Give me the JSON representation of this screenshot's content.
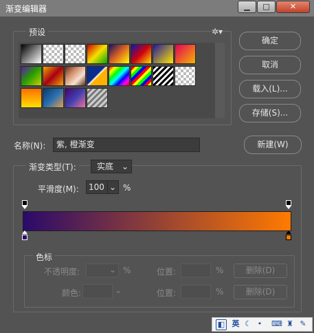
{
  "window": {
    "title": "渐变编辑器"
  },
  "presets": {
    "label": "预设",
    "gear_icon": "gear-icon",
    "swatches": [
      {
        "css": "linear-gradient(135deg,#000,#fff)"
      },
      {
        "css": "linear-gradient(135deg,#000,transparent)",
        "checker": true
      },
      {
        "css": "linear-gradient(135deg,#fff,transparent)",
        "checker": true
      },
      {
        "css": "linear-gradient(135deg,#c00,#f6e000,#0a0)"
      },
      {
        "css": "linear-gradient(135deg,#1a0f5c,#d62,#ff0)"
      },
      {
        "css": "linear-gradient(135deg,#0a1aa6,#d00010,#ffe000)"
      },
      {
        "css": "linear-gradient(135deg,#2318a0,#ffe500)"
      },
      {
        "css": "linear-gradient(135deg,#e2005a,#f6b400)"
      },
      {
        "css": "linear-gradient(135deg,#5a1aa6,#28a000,#c8d000)"
      },
      {
        "css": "linear-gradient(135deg,#f3a500,#a80012,#f3a500)"
      },
      {
        "css": "linear-gradient(135deg,#60301a,#d08e6a,#f8e0d0,#60301a)"
      },
      {
        "css": "linear-gradient(135deg,#0a2c8c 45%,#fff 50%,#ffb000 55%)"
      },
      {
        "css": "linear-gradient(135deg,#f00,#ff0,#0f0,#0ff,#00f,#f0f,#f00)"
      },
      {
        "css": "repeating-linear-gradient(135deg,#f00 0 4px,#ff0 4px 8px,#0f0 8px 12px,#00f 12px 16px)"
      },
      {
        "css": "repeating-linear-gradient(135deg,#000 0 3px,#fff 3px 6px)"
      },
      {
        "css": "transparent",
        "checker": true
      },
      {
        "css": "linear-gradient(180deg,#ff6d00,#ffe000)"
      },
      {
        "css": "linear-gradient(135deg,#0b3b6a,#2a6fb0,#e0a050)"
      },
      {
        "css": "linear-gradient(135deg,#4e006e,#4040b0,#f070a0)"
      },
      {
        "css": "repeating-linear-gradient(135deg,#ccc 0 3px,#777 3px 6px)"
      }
    ]
  },
  "buttons": {
    "ok": "确定",
    "cancel": "取消",
    "load": "载入(L)...",
    "save": "存储(S)...",
    "new": "新建(W)"
  },
  "name_field": {
    "label": "名称(N):",
    "value": "紫, 橙渐变"
  },
  "gradient": {
    "type_label": "渐变类型(T):",
    "type_value": "实底",
    "smooth_label": "平滑度(M):",
    "smooth_value": "100",
    "smooth_unit": "%",
    "start_color": "#2a0a6a",
    "end_color": "#ff7a00",
    "color_stop_left": "#2a0a6a",
    "color_stop_right": "#ff7a00",
    "opacity_stop_left": "#000000",
    "opacity_stop_right": "#000000"
  },
  "stops": {
    "legend": "色标",
    "opacity_label": "不透明度:",
    "opacity_unit": "%",
    "location_label": "位置:",
    "location_unit": "%",
    "delete_label": "删除(D)",
    "color_label": "颜色:"
  },
  "tray": {
    "lang": "英",
    "icons": [
      "ime-logo-icon",
      "moon-icon",
      "dot-icon",
      "keyboard-icon",
      "shirt-icon",
      "wrench-icon"
    ]
  }
}
